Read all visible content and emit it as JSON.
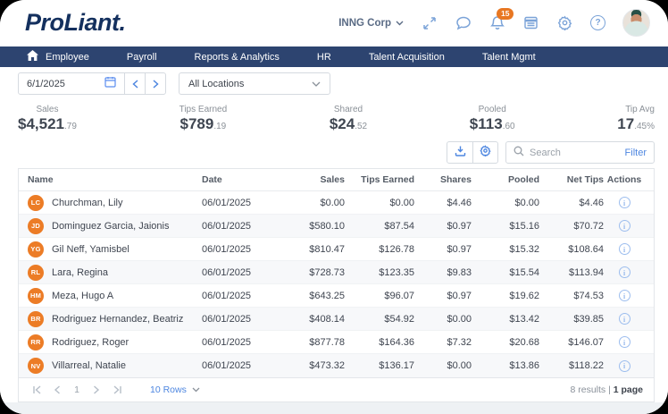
{
  "header": {
    "logo": "ProLiant.",
    "company": "INNG Corp",
    "notification_count": "15"
  },
  "nav": {
    "items": [
      {
        "label": "Employee"
      },
      {
        "label": "Payroll"
      },
      {
        "label": "Reports & Analytics"
      },
      {
        "label": "HR"
      },
      {
        "label": "Talent Acquisition"
      },
      {
        "label": "Talent Mgmt"
      }
    ]
  },
  "controls": {
    "date_value": "6/1/2025",
    "location_value": "All Locations"
  },
  "stats": [
    {
      "label": "Sales",
      "value_main": "$4,521",
      "value_cents": ".79"
    },
    {
      "label": "Tips Earned",
      "value_main": "$789",
      "value_cents": ".19"
    },
    {
      "label": "Shared",
      "value_main": "$24",
      "value_cents": ".52"
    },
    {
      "label": "Pooled",
      "value_main": "$113",
      "value_cents": ".60"
    },
    {
      "label": "Tip Avg",
      "value_main": "17",
      "value_cents": ".45%"
    }
  ],
  "toolbar": {
    "search_placeholder": "Search",
    "filter_label": "Filter"
  },
  "table": {
    "columns": [
      "Name",
      "Date",
      "Sales",
      "Tips Earned",
      "Shares",
      "Pooled",
      "Net Tips",
      "Actions"
    ],
    "rows": [
      {
        "initials": "LC",
        "name": "Churchman, Lily",
        "date": "06/01/2025",
        "sales": "$0.00",
        "tips_earned": "$0.00",
        "shares": "$4.46",
        "pooled": "$0.00",
        "net_tips": "$4.46"
      },
      {
        "initials": "JD",
        "name": "Dominguez Garcia, Jaionis",
        "date": "06/01/2025",
        "sales": "$580.10",
        "tips_earned": "$87.54",
        "shares": "$0.97",
        "pooled": "$15.16",
        "net_tips": "$70.72"
      },
      {
        "initials": "YG",
        "name": "Gil Neff, Yamisbel",
        "date": "06/01/2025",
        "sales": "$810.47",
        "tips_earned": "$126.78",
        "shares": "$0.97",
        "pooled": "$15.32",
        "net_tips": "$108.64"
      },
      {
        "initials": "RL",
        "name": "Lara, Regina",
        "date": "06/01/2025",
        "sales": "$728.73",
        "tips_earned": "$123.35",
        "shares": "$9.83",
        "pooled": "$15.54",
        "net_tips": "$113.94"
      },
      {
        "initials": "HM",
        "name": "Meza, Hugo A",
        "date": "06/01/2025",
        "sales": "$643.25",
        "tips_earned": "$96.07",
        "shares": "$0.97",
        "pooled": "$19.62",
        "net_tips": "$74.53"
      },
      {
        "initials": "BR",
        "name": "Rodriguez Hernandez, Beatriz",
        "date": "06/01/2025",
        "sales": "$408.14",
        "tips_earned": "$54.92",
        "shares": "$0.00",
        "pooled": "$13.42",
        "net_tips": "$39.85"
      },
      {
        "initials": "RR",
        "name": "Rodriguez, Roger",
        "date": "06/01/2025",
        "sales": "$877.78",
        "tips_earned": "$164.36",
        "shares": "$7.32",
        "pooled": "$20.68",
        "net_tips": "$146.07"
      },
      {
        "initials": "NV",
        "name": "Villarreal, Natalie",
        "date": "06/01/2025",
        "sales": "$473.32",
        "tips_earned": "$136.17",
        "shares": "$0.00",
        "pooled": "$13.86",
        "net_tips": "$118.22"
      }
    ]
  },
  "footer": {
    "page": "1",
    "rows_label": "10 Rows",
    "results": "8 results",
    "pages": "1 page"
  },
  "colors": {
    "navy": "#2d4470",
    "accent_blue": "#4d86e0",
    "icon_blue": "#7ba3d8",
    "orange": "#e87722"
  }
}
